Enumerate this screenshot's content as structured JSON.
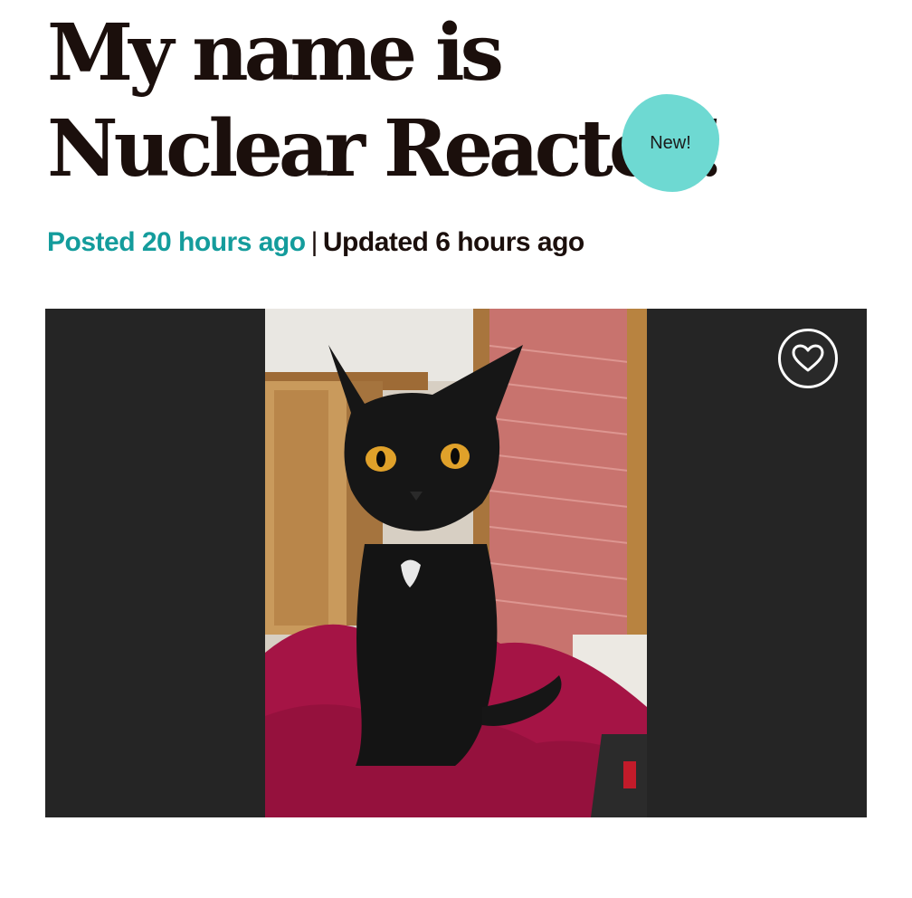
{
  "pet": {
    "title_line1": "My name is",
    "title_line2": "Nuclear Reactor!",
    "badge": "New!"
  },
  "meta": {
    "posted": "Posted 20 hours ago",
    "separator": "|",
    "updated": "Updated 6 hours ago"
  },
  "gallery": {
    "favorite_icon": "heart-outline-icon",
    "background_color": "#252525"
  },
  "colors": {
    "accent": "#149c9c",
    "badge": "#6ed9d2",
    "title": "#1b0f0c"
  }
}
